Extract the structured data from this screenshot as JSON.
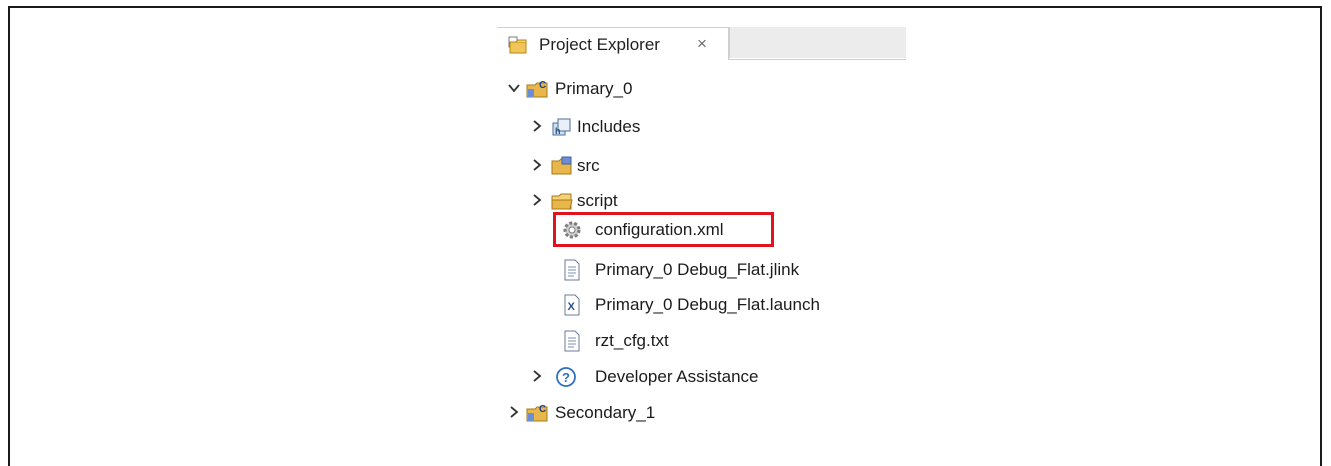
{
  "view": {
    "tab_label": "Project Explorer",
    "close_glyph": "×"
  },
  "tree": {
    "primary": {
      "label": "Primary_0",
      "expanded": true,
      "icon": "c-project-icon",
      "children": [
        {
          "label": "Includes",
          "icon": "includes-icon",
          "expandable": true
        },
        {
          "label": "src",
          "icon": "source-folder-icon",
          "expandable": true
        },
        {
          "label": "script",
          "icon": "folder-icon",
          "expandable": true
        },
        {
          "label": "configuration.xml",
          "icon": "gear-icon",
          "expandable": false,
          "highlighted": true
        },
        {
          "label": "Primary_0 Debug_Flat.jlink",
          "icon": "text-file-icon",
          "expandable": false
        },
        {
          "label": "Primary_0 Debug_Flat.launch",
          "icon": "launch-file-icon",
          "expandable": false
        },
        {
          "label": "rzt_cfg.txt",
          "icon": "text-file-icon",
          "expandable": false
        },
        {
          "label": "Developer Assistance",
          "icon": "help-icon",
          "expandable": true
        }
      ]
    },
    "secondary": {
      "label": "Secondary_1",
      "expanded": false,
      "icon": "c-project-icon"
    }
  },
  "colors": {
    "highlight_border": "#e0141e",
    "folder": "#e8b64b",
    "help": "#2f6fc0"
  }
}
